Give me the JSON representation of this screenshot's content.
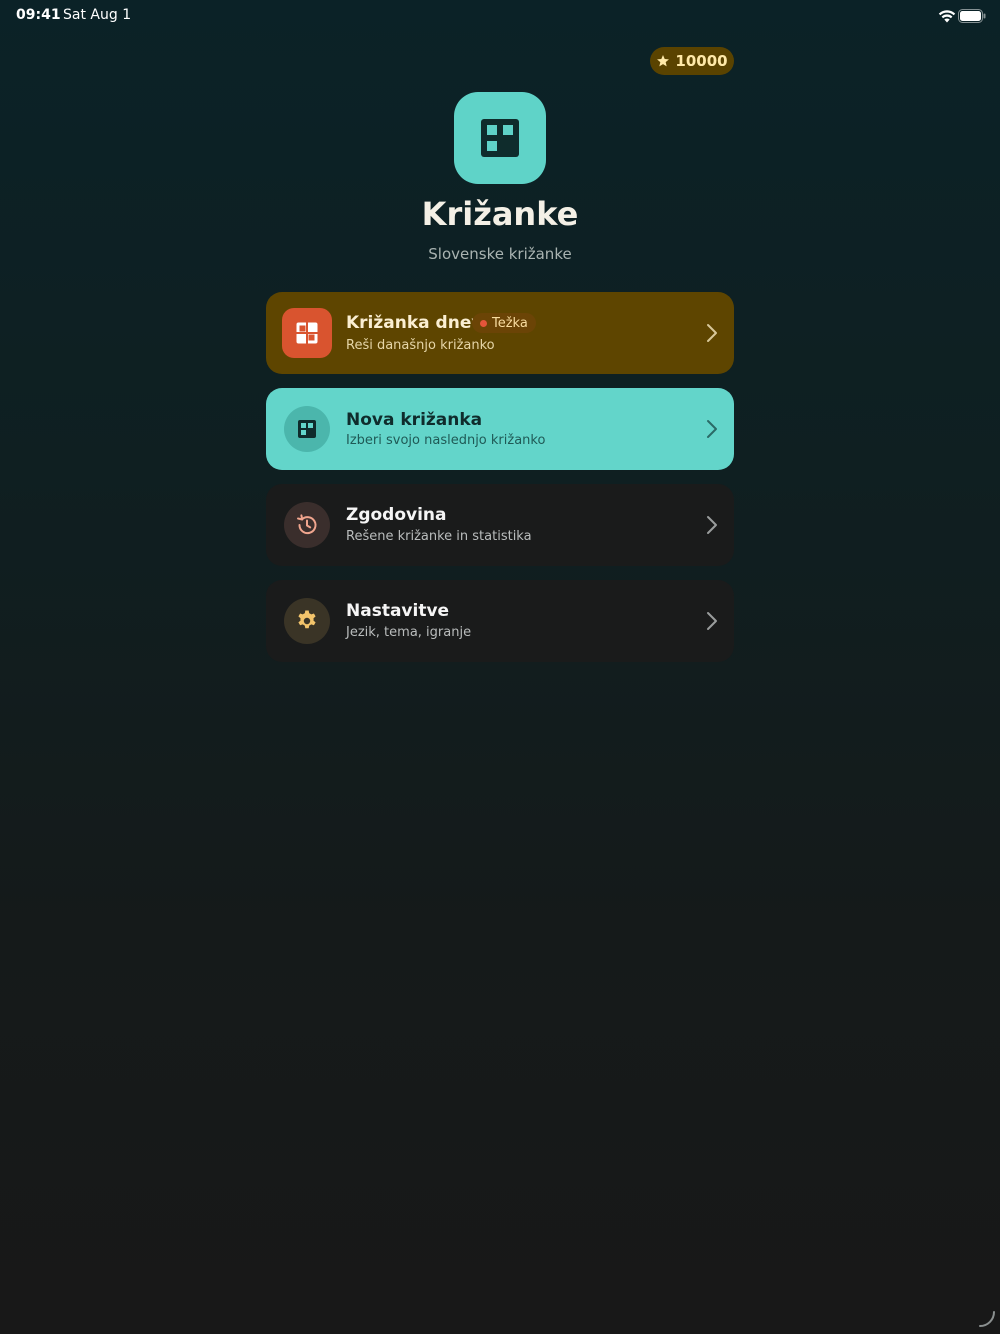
{
  "status_bar": {
    "time": "09:41",
    "date": "Sat Aug 1"
  },
  "coins": {
    "value": "10000",
    "icon": "star-icon"
  },
  "header": {
    "logo_icon": "crossword-grid-icon",
    "title": "Križanke",
    "subtitle": "Slovenske križanke"
  },
  "menu": {
    "daily": {
      "title": "Križanka dneva",
      "subtitle": "Reši današnjo križanko",
      "badge": "Težka",
      "icon": "crossword-grid-icon"
    },
    "new": {
      "title": "Nova križanka",
      "subtitle": "Izberi svojo naslednjo križanko",
      "icon": "crossword-grid-icon"
    },
    "history": {
      "title": "Zgodovina",
      "subtitle": "Rešene križanke in statistika",
      "icon": "history-icon"
    },
    "settings": {
      "title": "Nastavitve",
      "subtitle": "Jezik, tema, igranje",
      "icon": "gear-icon"
    }
  },
  "colors": {
    "accent_teal": "#63d5ca",
    "daily_card": "#5e4500",
    "daily_icon": "#d9542f",
    "badge_dot": "#e5553b"
  }
}
